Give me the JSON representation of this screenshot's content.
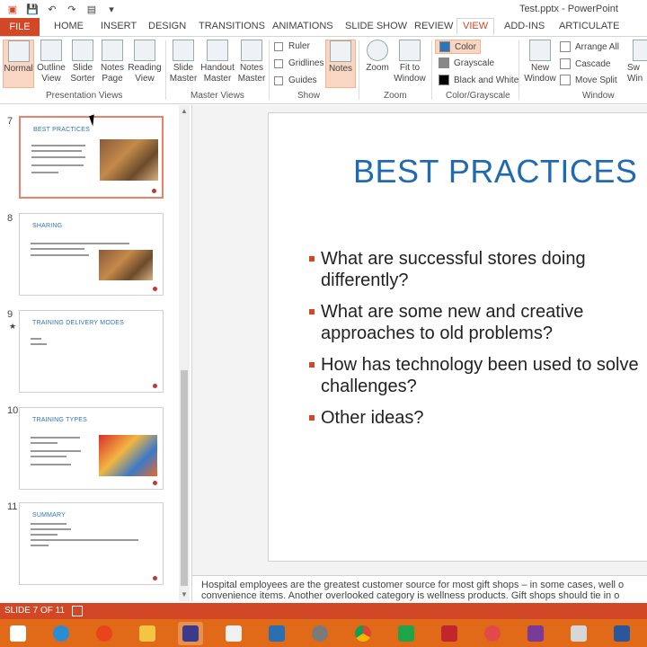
{
  "window": {
    "title": "Test.pptx - PowerPoint"
  },
  "tabs": [
    "FILE",
    "HOME",
    "INSERT",
    "DESIGN",
    "TRANSITIONS",
    "ANIMATIONS",
    "SLIDE SHOW",
    "REVIEW",
    "VIEW",
    "ADD-INS",
    "ARTICULATE"
  ],
  "ribbon": {
    "presentation_views": {
      "label": "Presentation Views",
      "buttons": [
        "Normal",
        "Outline View",
        "Slide Sorter",
        "Notes Page",
        "Reading View"
      ]
    },
    "master_views": {
      "label": "Master Views",
      "buttons": [
        "Slide Master",
        "Handout Master",
        "Notes Master"
      ]
    },
    "show": {
      "label": "Show",
      "checks": [
        "Ruler",
        "Gridlines",
        "Guides"
      ],
      "notes": "Notes"
    },
    "zoom": {
      "label": "Zoom",
      "buttons": [
        "Zoom",
        "Fit to Window"
      ]
    },
    "color": {
      "label": "Color/Grayscale",
      "options": [
        "Color",
        "Grayscale",
        "Black and White"
      ]
    },
    "window": {
      "label": "Window",
      "new_window": "New Window",
      "options": [
        "Arrange All",
        "Cascade",
        "Move Split"
      ],
      "switch": "Sw Win"
    }
  },
  "thumbnails": [
    {
      "num": "7",
      "title": "BEST PRACTICES",
      "has_image": true
    },
    {
      "num": "8",
      "title": "SHARING",
      "has_image": true
    },
    {
      "num": "9",
      "title": "TRAINING DELIVERY MODES",
      "has_image": false,
      "star": "★"
    },
    {
      "num": "10",
      "title": "TRAINING TYPES",
      "has_image": true
    },
    {
      "num": "11",
      "title": "SUMMARY",
      "has_image": false
    }
  ],
  "slide": {
    "title": "BEST PRACTICES",
    "bullets": [
      "What are successful stores doing differently?",
      "What are some new and creative approaches to old problems?",
      "How has technology been used to solve challenges?",
      "Other ideas?"
    ]
  },
  "notes": {
    "line1": "Hospital employees are the greatest customer source for most gift shops – in some cases, well o",
    "line2": "convenience items.  Another overlooked category is wellness products.  Gift shops should tie in o"
  },
  "status": {
    "slide_indicator": "SLIDE 7 OF 11"
  },
  "colors": {
    "accent": "#d24726",
    "title_blue": "#1f6ab0",
    "taskbar": "#e06a18"
  }
}
